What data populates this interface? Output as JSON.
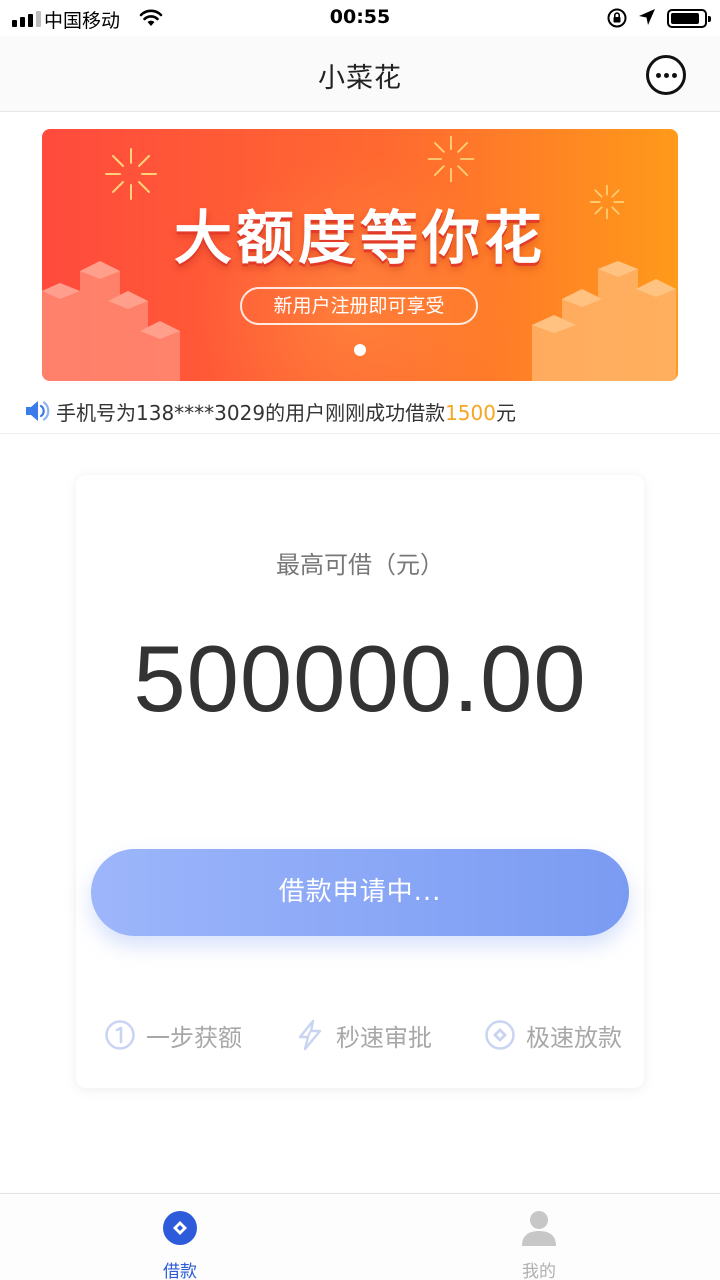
{
  "status_bar": {
    "carrier": "中国移动",
    "time": "00:55",
    "icons": [
      "signal-icon",
      "wifi-icon",
      "rotation-lock-icon",
      "location-icon",
      "battery-icon"
    ]
  },
  "navbar": {
    "title": "小菜花",
    "more_icon": "more-chat-icon"
  },
  "banner": {
    "headline": "大额度等你花",
    "subtitle": "新用户注册即可享受",
    "page_count": 1,
    "active_page": 1,
    "colors": {
      "start": "#ff4a3d",
      "end": "#ff9a1a"
    }
  },
  "notice": {
    "icon": "speaker-icon",
    "prefix": "手机号为138****3029的用户刚刚成功借款",
    "amount": "1500",
    "suffix": "元"
  },
  "loan_card": {
    "label": "最高可借（元）",
    "amount": "500000.00",
    "button_label": "借款申请中...",
    "features": [
      {
        "icon": "number-one-icon",
        "label": "一步获额"
      },
      {
        "icon": "lightning-icon",
        "label": "秒速审批"
      },
      {
        "icon": "coin-icon",
        "label": "极速放款"
      }
    ]
  },
  "tabbar": {
    "tabs": [
      {
        "icon": "loan-icon",
        "label": "借款",
        "active": true
      },
      {
        "icon": "user-icon",
        "label": "我的",
        "active": false
      }
    ],
    "colors": {
      "active": "#2d5bd9",
      "inactive": "#b0b0b0"
    }
  }
}
